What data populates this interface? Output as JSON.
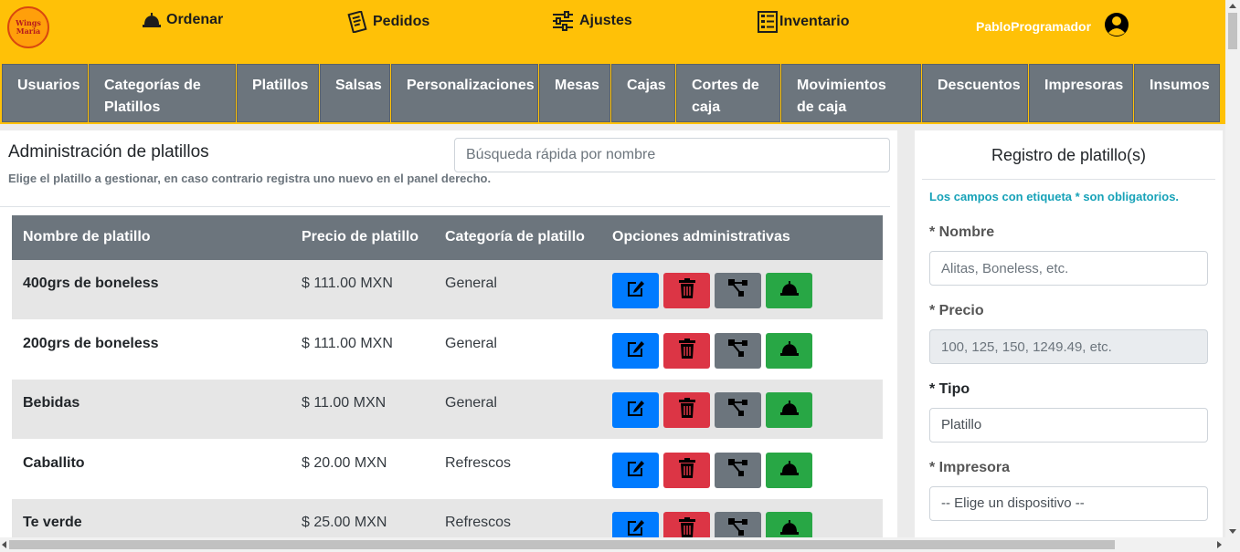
{
  "logo": {
    "line1": "Wings",
    "line2": "Maria"
  },
  "nav": {
    "ordenar": "Ordenar",
    "pedidos": "Pedidos",
    "ajustes": "Ajustes",
    "inventario": "Inventario",
    "user": "PabloProgramador"
  },
  "tabs": [
    {
      "label": "Usuarios"
    },
    {
      "label": "Categorías de Platillos"
    },
    {
      "label": "Platillos"
    },
    {
      "label": "Salsas"
    },
    {
      "label": "Personalizaciones"
    },
    {
      "label": "Mesas"
    },
    {
      "label": "Cajas"
    },
    {
      "label": "Cortes de caja"
    },
    {
      "label": "Movimientos de caja"
    },
    {
      "label": "Descuentos"
    },
    {
      "label": "Impresoras"
    },
    {
      "label": "Insumos"
    }
  ],
  "admin": {
    "title": "Administración de platillos",
    "subtitle": "Elige el platillo a gestionar, en caso contrario registra uno nuevo en el panel derecho.",
    "search_placeholder": "Búsqueda rápida por nombre"
  },
  "table": {
    "headers": [
      "Nombre de platillo",
      "Precio de platillo",
      "Categoría de platillo",
      "Opciones administrativas"
    ],
    "rows": [
      {
        "name": "400grs de boneless",
        "price": "$ 111.00 MXN",
        "category": "General"
      },
      {
        "name": "200grs de boneless",
        "price": "$ 111.00 MXN",
        "category": "General"
      },
      {
        "name": "Bebidas",
        "price": "$ 11.00 MXN",
        "category": "General"
      },
      {
        "name": "Caballito",
        "price": "$ 20.00 MXN",
        "category": "Refrescos"
      },
      {
        "name": "Te verde",
        "price": "$ 25.00 MXN",
        "category": "Refrescos"
      }
    ]
  },
  "form": {
    "title": "Registro de platillo(s)",
    "note": "Los campos con etiqueta * son obligatorios.",
    "nombre_label": "* Nombre",
    "nombre_placeholder": "Alitas, Boneless, etc.",
    "precio_label": "* Precio",
    "precio_placeholder": "100, 125, 150, 1249.49, etc.",
    "tipo_label": "* Tipo",
    "tipo_value": "Platillo",
    "impresora_label": "* Impresora",
    "impresora_value": "-- Elige un dispositivo --"
  },
  "colors": {
    "topbar": "#ffc107",
    "tab": "#6c757d",
    "edit": "#007bff",
    "delete": "#dc3545",
    "relations": "#6c757d",
    "order": "#28a745",
    "note": "#17a2b8"
  }
}
